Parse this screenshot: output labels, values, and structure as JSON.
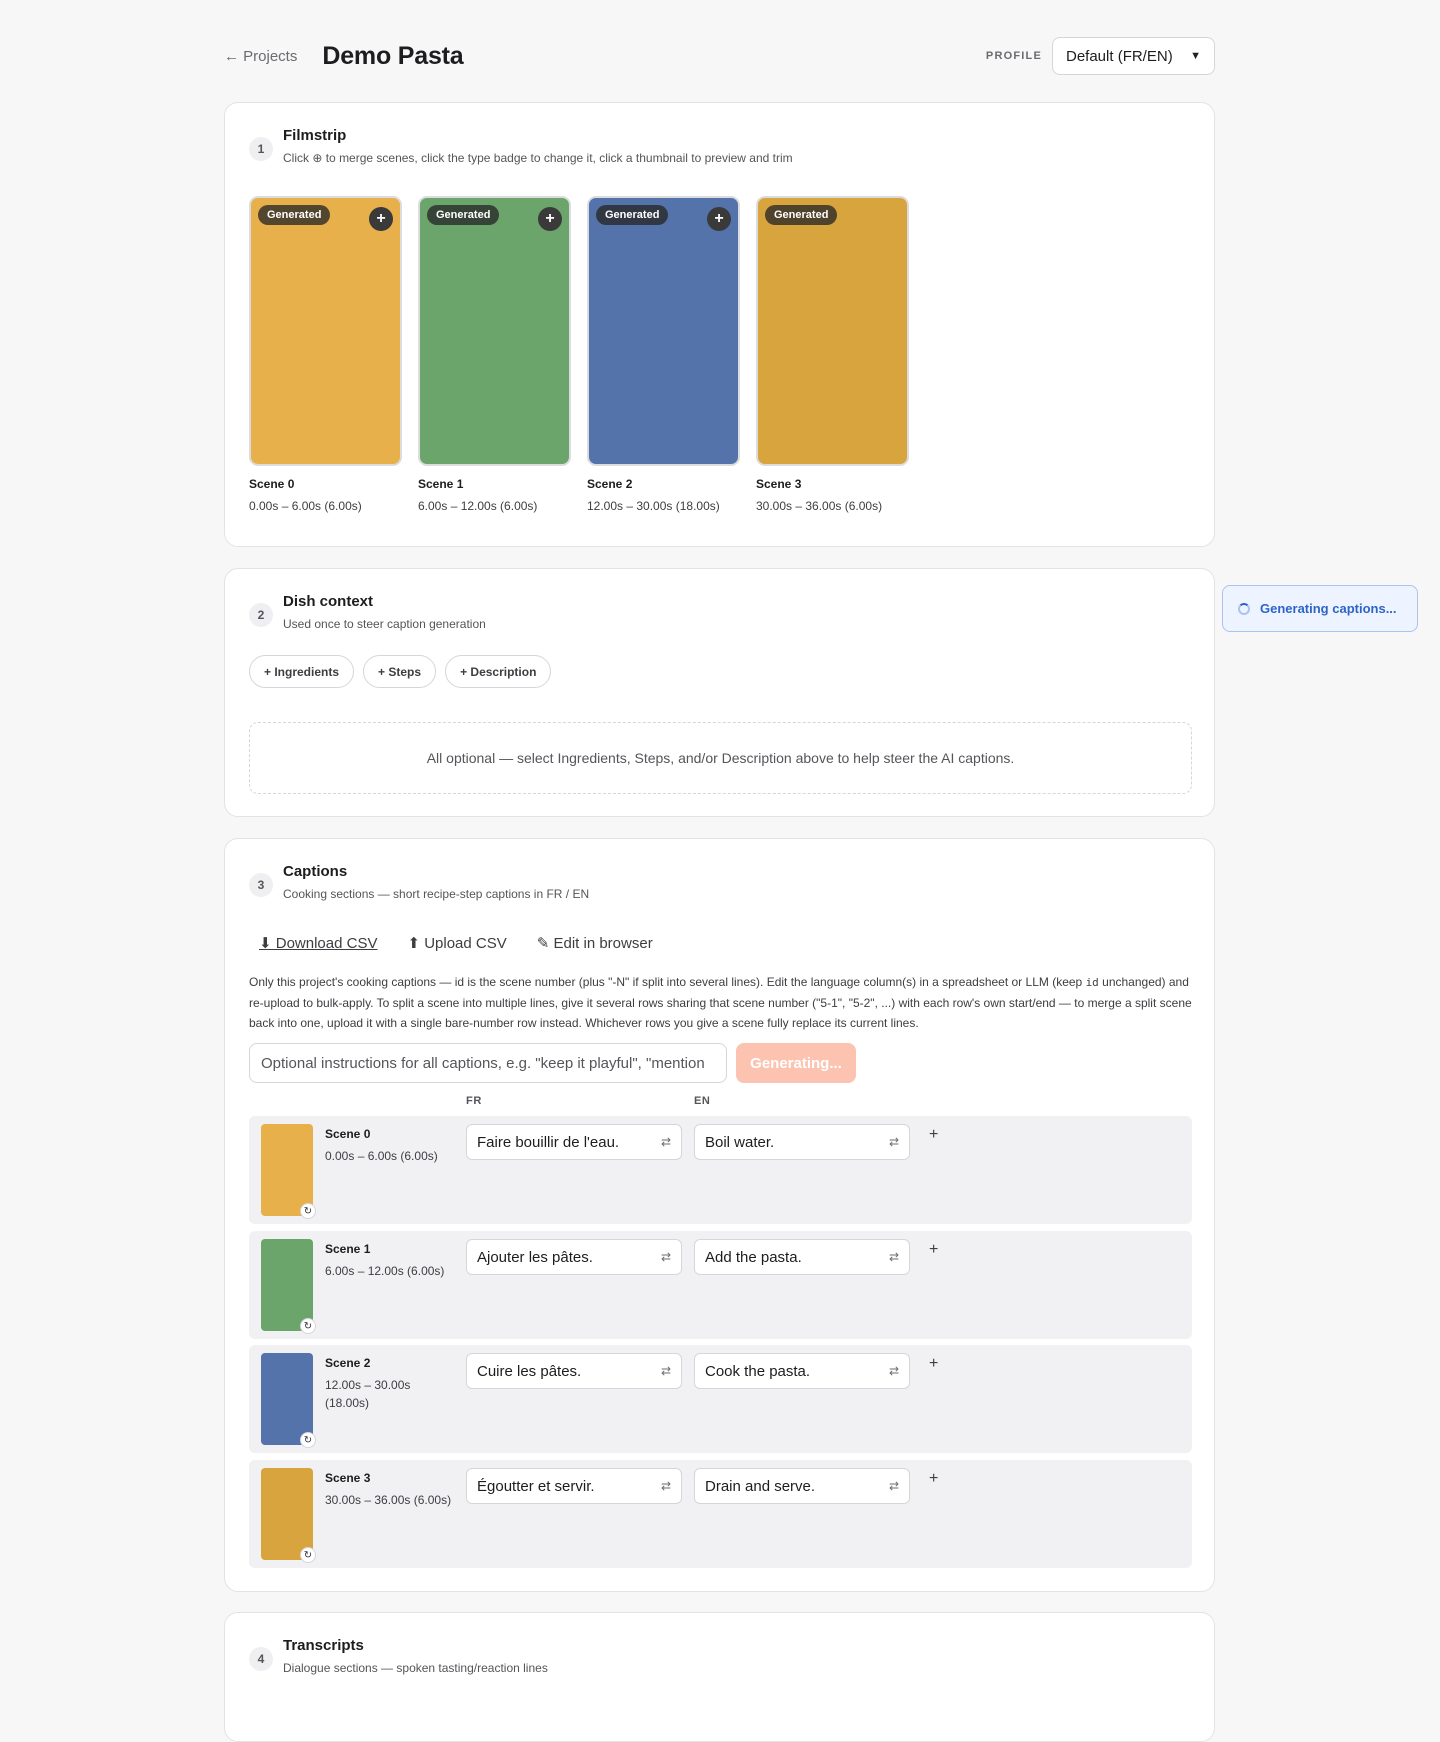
{
  "header": {
    "back_label": "← Projects",
    "title": "Demo Pasta",
    "profile_label": "PROFILE",
    "profile_value": "Default (FR/EN)"
  },
  "filmstrip": {
    "number": "1",
    "title": "Filmstrip",
    "subtitle": "Click ⊕ to merge scenes, click the type badge to change it, click a thumbnail to preview and trim",
    "scenes": [
      {
        "name": "Scene 0",
        "time": "0.00s – 6.00s (6.00s)",
        "badge": "Generated",
        "color": "#e8b04a",
        "merge": "+"
      },
      {
        "name": "Scene 1",
        "time": "6.00s – 12.00s (6.00s)",
        "badge": "Generated",
        "color": "#6ba56c",
        "merge": "+"
      },
      {
        "name": "Scene 2",
        "time": "12.00s – 30.00s (18.00s)",
        "badge": "Generated",
        "color": "#5473aa",
        "merge": "+"
      },
      {
        "name": "Scene 3",
        "time": "30.00s – 36.00s (6.00s)",
        "badge": "Generated",
        "color": "#d8a43e"
      }
    ]
  },
  "dish_context": {
    "number": "2",
    "title": "Dish context",
    "subtitle": "Used once to steer caption generation",
    "chips": [
      "+ Ingredients",
      "+ Steps",
      "+ Description"
    ],
    "empty_text": "All optional — select Ingredients, Steps, and/or Description above to help steer the AI captions."
  },
  "toast": {
    "text": "Generating captions..."
  },
  "captions": {
    "number": "3",
    "title": "Captions",
    "subtitle": "Cooking sections — short recipe-step captions in FR / EN",
    "download_label": "⬇ Download CSV",
    "upload_label": "⬆ Upload CSV",
    "edit_label": "✎ Edit in browser",
    "help_1": "Only this project's cooking captions — id is the scene number (plus \"-N\" if split into several lines). Edit the language column(s) in a spreadsheet or LLM (keep",
    "help_code": "id",
    "help_2": "unchanged) and re-upload to bulk-apply. To split a scene into multiple lines, give it several rows sharing that scene number (\"5-1\", \"5-2\", ...) with each row's own start/end — to merge a split scene back into one, upload it with a single bare-number row instead. Whichever rows you give a scene fully replace its current lines.",
    "instructions_placeholder": "Optional instructions for all captions, e.g. \"keep it playful\", \"mention",
    "generate_label": "Generating...",
    "col_fr": "FR",
    "col_en": "EN",
    "rows": [
      {
        "name": "Scene 0",
        "time": "0.00s – 6.00s (6.00s)",
        "fr": "Faire bouillir de l'eau.",
        "en": "Boil water.",
        "color": "#e8b04a"
      },
      {
        "name": "Scene 1",
        "time": "6.00s – 12.00s (6.00s)",
        "fr": "Ajouter les pâtes.",
        "en": "Add the pasta.",
        "color": "#6ba56c"
      },
      {
        "name": "Scene 2",
        "time": "12.00s – 30.00s (18.00s)",
        "fr": "Cuire les pâtes.",
        "en": "Cook the pasta.",
        "color": "#5473aa"
      },
      {
        "name": "Scene 3",
        "time": "30.00s – 36.00s (6.00s)",
        "fr": "Égoutter et servir.",
        "en": "Drain and serve.",
        "color": "#d8a43e"
      }
    ],
    "swap_icon": "⇄",
    "add_icon": "+",
    "refresh_icon": "↻"
  },
  "transcripts": {
    "number": "4",
    "title": "Transcripts",
    "subtitle": "Dialogue sections — spoken tasting/reaction lines"
  }
}
